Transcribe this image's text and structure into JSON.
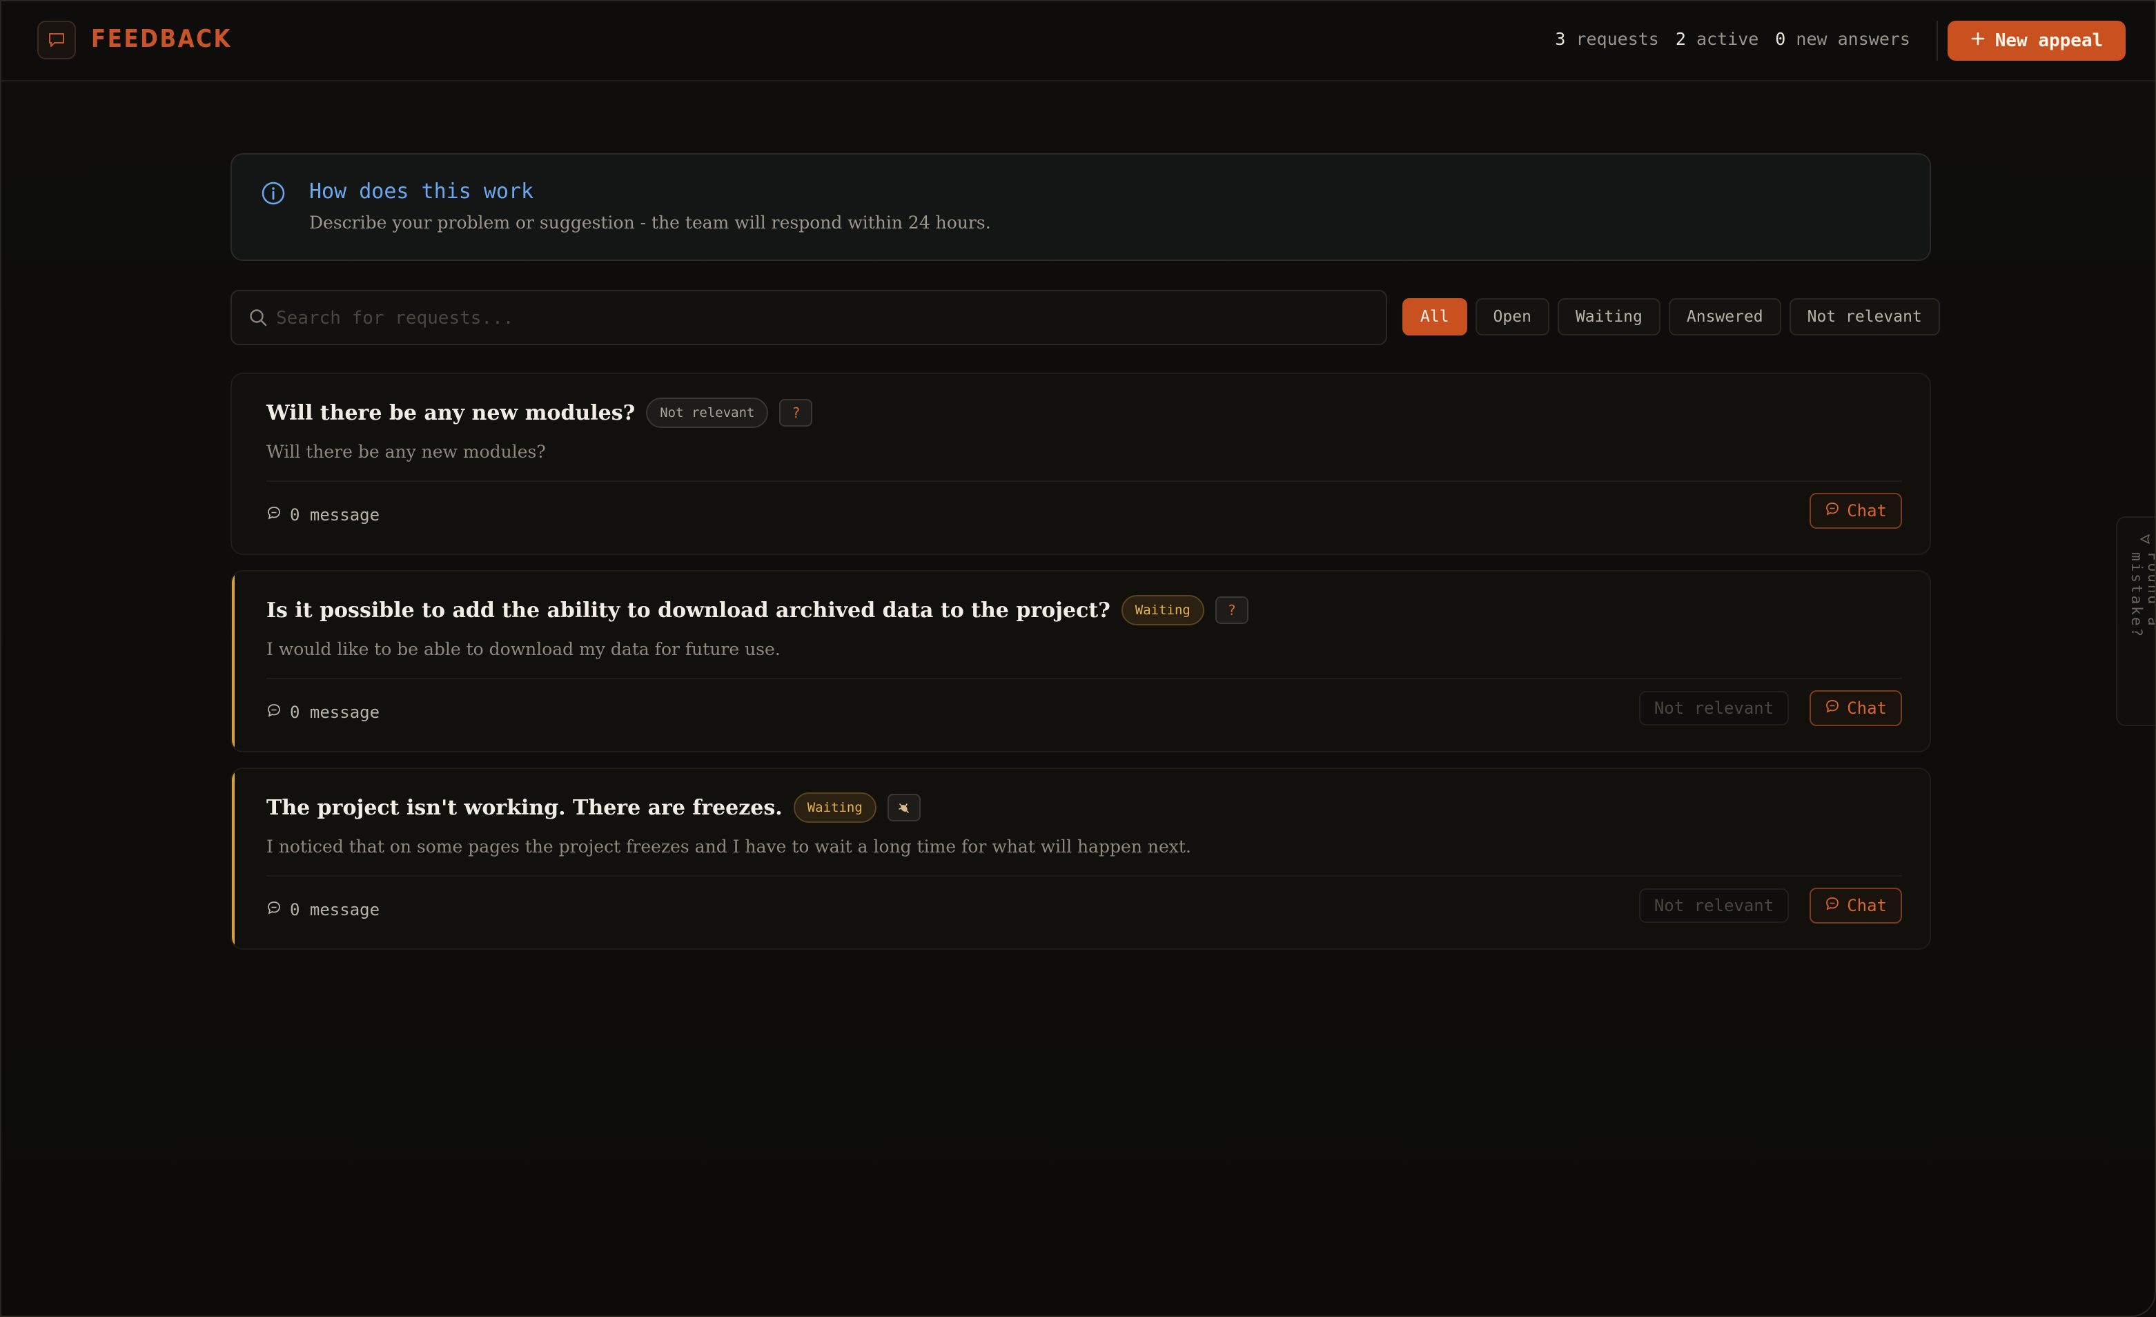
{
  "header": {
    "logo_text": "FEEDBACK",
    "stats": {
      "requests_count": "3",
      "requests_label": "requests",
      "active_count": "2",
      "active_label": "active",
      "new_answers_count": "0",
      "new_answers_label": "new answers"
    },
    "new_appeal_label": "New appeal"
  },
  "info": {
    "title": "How does this work",
    "text": "Describe your problem or suggestion - the team will respond within 24 hours."
  },
  "search": {
    "placeholder": "Search for requests..."
  },
  "filters": {
    "selected": "All",
    "items": [
      {
        "label": "All"
      },
      {
        "label": "Open"
      },
      {
        "label": "Waiting"
      },
      {
        "label": "Answered"
      },
      {
        "label": "Not relevant"
      }
    ]
  },
  "cards": [
    {
      "title": "Will there be any new modules?",
      "status": "Not relevant",
      "tag": "?",
      "description": "Will there be any new modules?",
      "messages": "0 message",
      "chat_label": "Chat"
    },
    {
      "title": "Is it possible to add the ability to download archived data to the project?",
      "status": "Waiting",
      "tag": "?",
      "description": "I would like to be able to download my data for future use.",
      "messages": "0 message",
      "not_relevant_label": "Not relevant",
      "chat_label": "Chat"
    },
    {
      "title": "The project isn't working. There are freezes.",
      "status": "Waiting",
      "tag_icon": "bug-icon",
      "description": "I noticed that on some pages the project freezes and I have to wait a long time for what will happen next.",
      "messages": "0 message",
      "not_relevant_label": "Not relevant",
      "chat_label": "Chat"
    }
  ],
  "side_tab": {
    "label": "Found a mistake?"
  },
  "colors": {
    "accent": "#c9511f",
    "info_blue": "#6aa8f0",
    "waiting": "#e6b14a",
    "background": "#0d0c0a"
  }
}
